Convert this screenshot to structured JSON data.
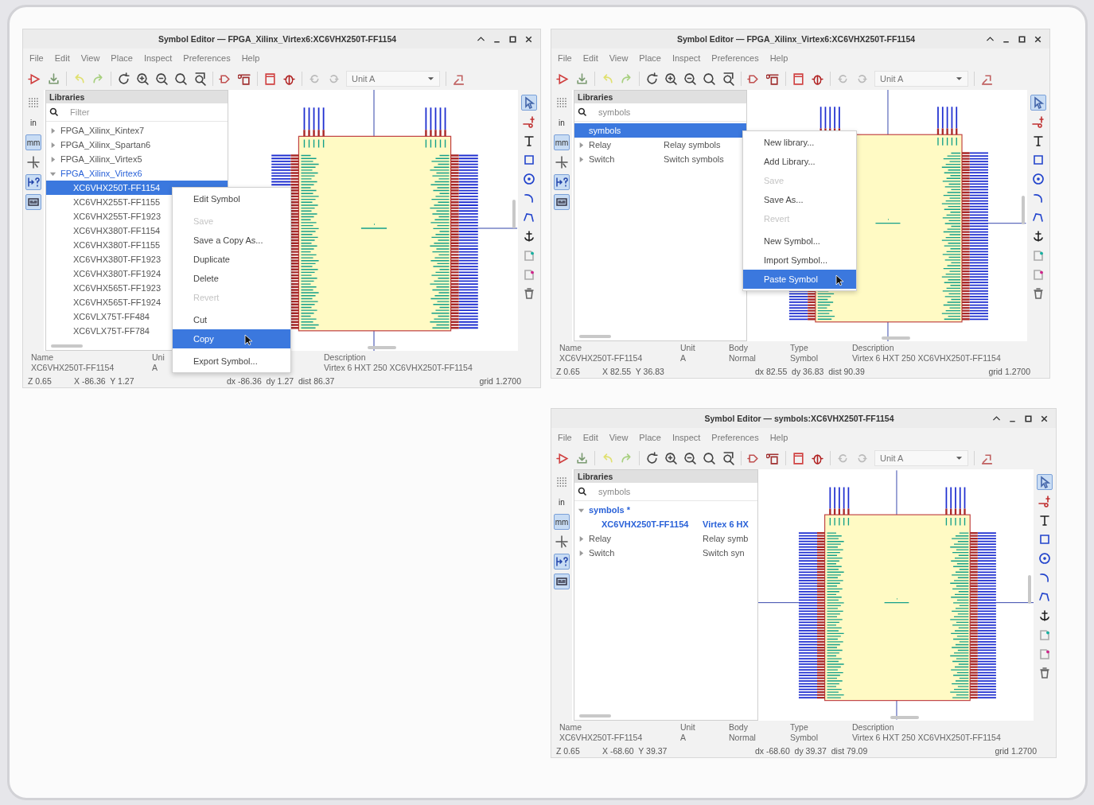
{
  "windows": [
    {
      "title": "Symbol Editor — FPGA_Xilinx_Virtex6:XC6VHX250T-FF1154",
      "menu": [
        "File",
        "Edit",
        "View",
        "Place",
        "Inspect",
        "Preferences",
        "Help"
      ],
      "unit_selector": "Unit A",
      "left_tools": [
        {
          "kind": "grid",
          "on": false
        },
        {
          "kind": "unit",
          "label": "in",
          "on": false
        },
        {
          "kind": "unit",
          "label": "mm",
          "on": true
        },
        {
          "kind": "cursor",
          "on": false
        },
        {
          "kind": "pin-length",
          "on": true
        },
        {
          "kind": "pin-names",
          "on": true
        }
      ],
      "right_tools": [
        {
          "kind": "select",
          "on": true
        },
        {
          "kind": "pin",
          "on": false
        },
        {
          "kind": "text",
          "on": false
        },
        {
          "kind": "rectangle",
          "on": false
        },
        {
          "kind": "circle",
          "on": false
        },
        {
          "kind": "arc",
          "on": false
        },
        {
          "kind": "polyline",
          "on": false
        },
        {
          "kind": "anchor",
          "on": false
        },
        {
          "kind": "graphic-cyan",
          "on": false
        },
        {
          "kind": "graphic-magenta",
          "on": false
        },
        {
          "kind": "delete",
          "on": false
        }
      ],
      "libraries": {
        "title": "Libraries",
        "search_placeholder": "Filter"
      },
      "tree": [
        {
          "label": "FPGA_Xilinx_Kintex7",
          "expanded": false,
          "current": false,
          "selected": false
        },
        {
          "label": "FPGA_Xilinx_Spartan6",
          "expanded": false,
          "current": false,
          "selected": false
        },
        {
          "label": "FPGA_Xilinx_Virtex5",
          "expanded": false,
          "current": false,
          "selected": false
        },
        {
          "label": "FPGA_Xilinx_Virtex6",
          "expanded": true,
          "current": true,
          "selected": false,
          "children": [
            {
              "label": "XC6VHX250T-FF1154",
              "current": false,
              "selected": true
            },
            {
              "label": "XC6VHX255T-FF1155",
              "current": false,
              "selected": false
            },
            {
              "label": "XC6VHX255T-FF1923",
              "current": false,
              "selected": false
            },
            {
              "label": "XC6VHX380T-FF1154",
              "current": false,
              "selected": false
            },
            {
              "label": "XC6VHX380T-FF1155",
              "current": false,
              "selected": false
            },
            {
              "label": "XC6VHX380T-FF1923",
              "current": false,
              "selected": false
            },
            {
              "label": "XC6VHX380T-FF1924",
              "current": false,
              "selected": false
            },
            {
              "label": "XC6VHX565T-FF1923",
              "current": false,
              "selected": false
            },
            {
              "label": "XC6VHX565T-FF1924",
              "current": false,
              "selected": false
            },
            {
              "label": "XC6VLX75T-FF484",
              "current": false,
              "selected": false
            },
            {
              "label": "XC6VLX75T-FF784",
              "current": false,
              "selected": false
            }
          ]
        }
      ],
      "context_menu": [
        {
          "kind": "item",
          "label": "Edit Symbol",
          "disabled": false,
          "selected": false
        },
        {
          "kind": "separator"
        },
        {
          "kind": "item",
          "label": "Save",
          "disabled": true,
          "selected": false
        },
        {
          "kind": "item",
          "label": "Save a Copy As...",
          "disabled": false,
          "selected": false
        },
        {
          "kind": "item",
          "label": "Duplicate",
          "disabled": false,
          "selected": false
        },
        {
          "kind": "item",
          "label": "Delete",
          "disabled": false,
          "selected": false
        },
        {
          "kind": "item",
          "label": "Revert",
          "disabled": true,
          "selected": false
        },
        {
          "kind": "separator"
        },
        {
          "kind": "item",
          "label": "Cut",
          "disabled": false,
          "selected": false
        },
        {
          "kind": "item",
          "label": "Copy",
          "disabled": false,
          "selected": true
        },
        {
          "kind": "separator"
        },
        {
          "kind": "item",
          "label": "Export Symbol...",
          "disabled": false,
          "selected": false
        }
      ],
      "info": [
        {
          "kind": "name",
          "label": "Name",
          "value": "XC6VHX250T-FF1154"
        },
        {
          "kind": "unit",
          "label": "Uni",
          "value": "A"
        },
        {
          "kind": "description",
          "label": "Description",
          "value": "Virtex 6 HXT 250 XC6VHX250T-FF1154"
        }
      ],
      "status": {
        "zoom": "Z 0.65",
        "cursor": "X -86.36  Y 1.27",
        "delta": "dx -86.36  dy 1.27  dist 86.37",
        "grid": "grid 1.2700"
      }
    },
    {
      "title": "Symbol Editor — FPGA_Xilinx_Virtex6:XC6VHX250T-FF1154",
      "menu": [
        "File",
        "Edit",
        "View",
        "Place",
        "Inspect",
        "Preferences",
        "Help"
      ],
      "unit_selector": "Unit A",
      "left_tools": [
        {
          "kind": "grid",
          "on": false
        },
        {
          "kind": "unit",
          "label": "in",
          "on": false
        },
        {
          "kind": "unit",
          "label": "mm",
          "on": true
        },
        {
          "kind": "cursor",
          "on": false
        },
        {
          "kind": "pin-length",
          "on": true
        },
        {
          "kind": "pin-names",
          "on": true
        }
      ],
      "right_tools": [
        {
          "kind": "select",
          "on": true
        },
        {
          "kind": "pin",
          "on": false
        },
        {
          "kind": "text",
          "on": false
        },
        {
          "kind": "rectangle",
          "on": false
        },
        {
          "kind": "circle",
          "on": false
        },
        {
          "kind": "arc",
          "on": false
        },
        {
          "kind": "polyline",
          "on": false
        },
        {
          "kind": "anchor",
          "on": false
        },
        {
          "kind": "graphic-cyan",
          "on": false
        },
        {
          "kind": "graphic-magenta",
          "on": false
        },
        {
          "kind": "delete",
          "on": false
        }
      ],
      "libraries": {
        "title": "Libraries",
        "search_value": "symbols"
      },
      "tree": [
        {
          "label": "symbols",
          "current": false,
          "selected": true
        },
        {
          "label": "Relay",
          "description": "Relay symbols",
          "expanded": false,
          "current": false,
          "selected": false
        },
        {
          "label": "Switch",
          "description": "Switch symbols",
          "expanded": false,
          "current": false,
          "selected": false
        }
      ],
      "context_menu": [
        {
          "kind": "item",
          "label": "New library...",
          "disabled": false,
          "selected": false
        },
        {
          "kind": "item",
          "label": "Add Library...",
          "disabled": false,
          "selected": false
        },
        {
          "kind": "item",
          "label": "Save",
          "disabled": true,
          "selected": false
        },
        {
          "kind": "item",
          "label": "Save As...",
          "disabled": false,
          "selected": false
        },
        {
          "kind": "item",
          "label": "Revert",
          "disabled": true,
          "selected": false
        },
        {
          "kind": "separator"
        },
        {
          "kind": "item",
          "label": "New Symbol...",
          "disabled": false,
          "selected": false
        },
        {
          "kind": "item",
          "label": "Import Symbol...",
          "disabled": false,
          "selected": false
        },
        {
          "kind": "item",
          "label": "Paste Symbol",
          "disabled": false,
          "selected": true
        }
      ],
      "info": [
        {
          "kind": "name",
          "label": "Name",
          "value": "XC6VHX250T-FF1154"
        },
        {
          "kind": "unit",
          "label": "Unit",
          "value": "A"
        },
        {
          "kind": "body",
          "label": "Body",
          "value": "Normal"
        },
        {
          "kind": "type",
          "label": "Type",
          "value": "Symbol"
        },
        {
          "kind": "description",
          "label": "Description",
          "value": "Virtex 6 HXT 250 XC6VHX250T-FF1154"
        }
      ],
      "status": {
        "zoom": "Z 0.65",
        "cursor": "X 82.55  Y 36.83",
        "delta": "dx 82.55  dy 36.83  dist 90.39",
        "grid": "grid 1.2700"
      }
    },
    {
      "title": "Symbol Editor — symbols:XC6VHX250T-FF1154",
      "menu": [
        "File",
        "Edit",
        "View",
        "Place",
        "Inspect",
        "Preferences",
        "Help"
      ],
      "unit_selector": "Unit A",
      "left_tools": [
        {
          "kind": "grid",
          "on": false
        },
        {
          "kind": "unit",
          "label": "in",
          "on": false
        },
        {
          "kind": "unit",
          "label": "mm",
          "on": true
        },
        {
          "kind": "cursor",
          "on": false
        },
        {
          "kind": "pin-length",
          "on": true
        },
        {
          "kind": "pin-names",
          "on": true
        }
      ],
      "right_tools": [
        {
          "kind": "select",
          "on": true
        },
        {
          "kind": "pin",
          "on": false
        },
        {
          "kind": "text",
          "on": false
        },
        {
          "kind": "rectangle",
          "on": false
        },
        {
          "kind": "circle",
          "on": false
        },
        {
          "kind": "arc",
          "on": false
        },
        {
          "kind": "polyline",
          "on": false
        },
        {
          "kind": "anchor",
          "on": false
        },
        {
          "kind": "graphic-cyan",
          "on": false
        },
        {
          "kind": "graphic-magenta",
          "on": false
        },
        {
          "kind": "delete",
          "on": false
        }
      ],
      "libraries": {
        "title": "Libraries",
        "search_value": "symbols"
      },
      "tree": [
        {
          "label": "symbols *",
          "expanded": true,
          "current": true,
          "modified": true,
          "selected": false,
          "children": [
            {
              "label": "XC6VHX250T-FF1154",
              "description": "Virtex 6 HX",
              "current": true,
              "modified": true,
              "selected": false
            }
          ]
        },
        {
          "label": "Relay",
          "description": "Relay symb",
          "expanded": false,
          "current": false,
          "selected": false
        },
        {
          "label": "Switch",
          "description": "Switch syn",
          "expanded": false,
          "current": false,
          "selected": false
        }
      ],
      "info": [
        {
          "kind": "name",
          "label": "Name",
          "value": "XC6VHX250T-FF1154"
        },
        {
          "kind": "unit",
          "label": "Unit",
          "value": "A"
        },
        {
          "kind": "body",
          "label": "Body",
          "value": "Normal"
        },
        {
          "kind": "type",
          "label": "Type",
          "value": "Symbol"
        },
        {
          "kind": "description",
          "label": "Description",
          "value": "Virtex 6 HXT 250 XC6VHX250T-FF1154"
        }
      ],
      "status": {
        "zoom": "Z 0.65",
        "cursor": "X -68.60  Y 39.37",
        "delta": "dx -68.60  dy 39.37  dist 79.09",
        "grid": "grid 1.2700"
      }
    }
  ]
}
